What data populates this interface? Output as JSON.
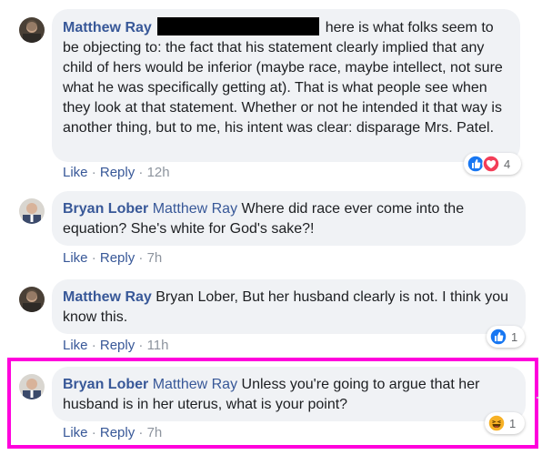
{
  "comments": [
    {
      "author": "Matthew Ray",
      "text": "here is what folks seem to be objecting to: the fact that his statement clearly implied that any child of hers would be inferior (maybe race, maybe intellect, not sure what he was specifically getting at). That is what people see when they look at that statement. Whether or not he intended it that way is another thing, but to me, his intent was clear: disparage Mrs. Patel.",
      "like_label": "Like",
      "reply_label": "Reply",
      "time": "12h",
      "reaction_count": "4",
      "reactions": [
        "like-icon",
        "love-icon"
      ]
    },
    {
      "author": "Bryan Lober",
      "mention": "Matthew Ray",
      "text": "Where did race ever come into the equation? She's white for God's sake?!",
      "like_label": "Like",
      "reply_label": "Reply",
      "time": "7h"
    },
    {
      "author": "Matthew Ray",
      "mention": "Bryan Lober",
      "text": ", But her husband clearly is not. I think you know this.",
      "like_label": "Like",
      "reply_label": "Reply",
      "time": "11h",
      "reaction_count": "1",
      "reactions": [
        "like-icon"
      ]
    },
    {
      "author": "Bryan Lober",
      "mention": "Matthew Ray",
      "text": "Unless you're going to argue that her husband is in her uterus, what is your point?",
      "like_label": "Like",
      "reply_label": "Reply",
      "time": "7h",
      "reaction_count": "1",
      "reactions": [
        "haha-icon"
      ]
    }
  ],
  "action_separator": "·",
  "colors": {
    "author_link": "#385898",
    "bubble": "#f0f2f5",
    "highlight_border": "#ff00dc",
    "like_blue": "#1877f2",
    "love_red": "#f33e58",
    "haha_yellow": "#f7b125"
  }
}
